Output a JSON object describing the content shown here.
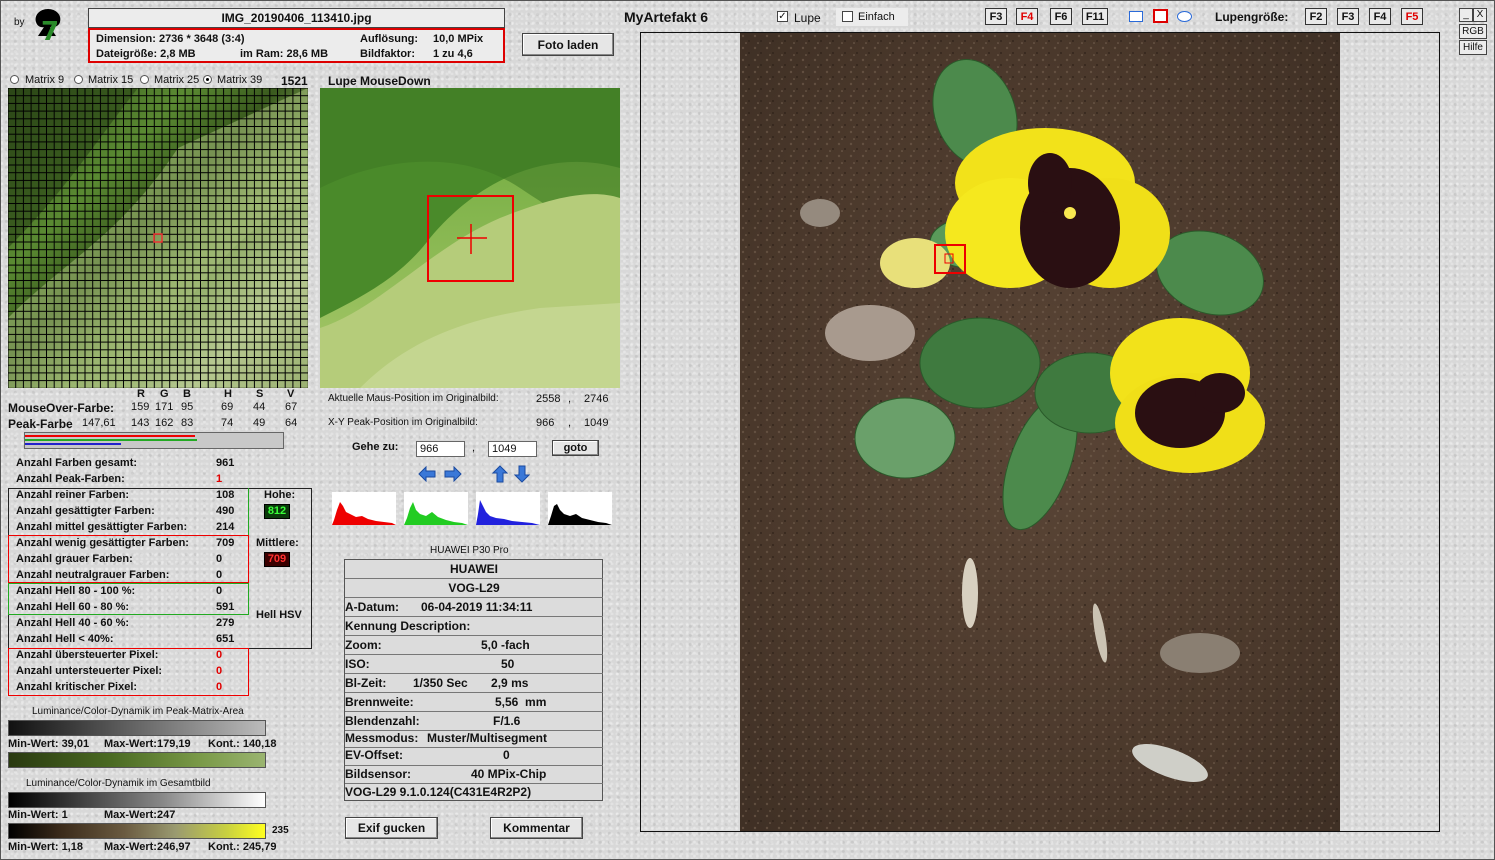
{
  "header": {
    "by_label": "by",
    "filename": "IMG_20190406_113410.jpg",
    "dimension": "Dimension: 2736 * 3648 (3:4)",
    "resolution_label": "Auflösung:",
    "resolution_value": "10,0 MPix",
    "filesize": "Dateigröße: 2,8 MB",
    "ram": "im Ram: 28,6 MB",
    "factor_label": "Bildfaktor:",
    "factor_value": "1 zu 4,6",
    "load_button": "Foto laden",
    "app_title": "MyArtefakt 6",
    "lupe_label": "Lupe",
    "einfach_label": "Einfach",
    "fkeys_left": [
      "F3",
      "F4",
      "F6",
      "F11"
    ],
    "lupengroesse_label": "Lupengröße:",
    "fkeys_right": [
      "F2",
      "F3",
      "F4",
      "F5"
    ],
    "window_controls": [
      "_",
      "X"
    ],
    "rgb_button": "RGB",
    "hilfe_button": "Hilfe"
  },
  "matrix": {
    "options": [
      "Matrix 9",
      "Matrix 15",
      "Matrix 25",
      "Matrix 39"
    ],
    "selected": "Matrix 39",
    "count": "1521",
    "lupe_title": "Lupe MouseDown"
  },
  "colors": {
    "cols": [
      "R",
      "G",
      "B",
      "H",
      "S",
      "V"
    ],
    "mouseover_label": "MouseOver-Farbe:",
    "mouseover_vals": [
      "159",
      "171",
      "95",
      "69",
      "44",
      "67"
    ],
    "peak_label": "Peak-Farbe",
    "peak_extra": "147,61",
    "peak_vals": [
      "143",
      "162",
      "83",
      "74",
      "49",
      "64"
    ]
  },
  "position": {
    "current_label": "Aktuelle Maus-Position  im Originalbild:",
    "current_x": "2558",
    "current_y": "2746",
    "peak_label": "X-Y Peak-Position  im Originalbild:",
    "peak_x": "966",
    "peak_y": "1049",
    "sep": ",",
    "goto_label": "Gehe zu:",
    "goto_x": "966",
    "goto_y": "1049",
    "goto_button": "goto"
  },
  "stats": {
    "rows": [
      {
        "label": "Anzahl Farben gesamt:",
        "value": "961",
        "red": false
      },
      {
        "label": "Anzahl Peak-Farben:",
        "value": "1",
        "red": true
      },
      {
        "label": "Anzahl reiner Farben:",
        "value": "108",
        "red": false
      },
      {
        "label": "Anzahl gesättigter Farben:",
        "value": "490",
        "red": false
      },
      {
        "label": "Anzahl mittel gesättigter Farben:",
        "value": "214",
        "red": false
      },
      {
        "label": "Anzahl wenig gesättigter Farben:",
        "value": "709",
        "red": false
      },
      {
        "label": "Anzahl grauer Farben:",
        "value": "0",
        "red": false
      },
      {
        "label": "Anzahl neutralgrauer Farben:",
        "value": "0",
        "red": false
      },
      {
        "label": "Anzahl Hell 80 - 100 %:",
        "value": "0",
        "red": false
      },
      {
        "label": "Anzahl Hell 60 - 80 %:",
        "value": "591",
        "red": false
      },
      {
        "label": "Anzahl Hell 40 - 60 %:",
        "value": "279",
        "red": false
      },
      {
        "label": "Anzahl Hell < 40%:",
        "value": "651",
        "red": false
      },
      {
        "label": "Anzahl übersteuerter Pixel:",
        "value": "0",
        "red": true
      },
      {
        "label": "Anzahl untersteuerter Pixel:",
        "value": "0",
        "red": true
      },
      {
        "label": "Anzahl kritischer Pixel:",
        "value": "0",
        "red": true
      }
    ],
    "hohe_label": "Hohe:",
    "hohe_value": "812",
    "mittlere_label": "Mittlere:",
    "mittlere_value": "709",
    "hell_hsv_label": "Hell HSV"
  },
  "dynamics": {
    "peak_title": "Luminance/Color-Dynamik im Peak-Matrix-Area",
    "peak_min": "Min-Wert: 39,01",
    "peak_max": "Max-Wert:179,19",
    "peak_kont": "Kont.: 140,18",
    "total_title": "Luminance/Color-Dynamik im Gesamtbild",
    "total_min": "Min-Wert: 1",
    "total_max": "Max-Wert:247",
    "total_min2": "Min-Wert: 1,18",
    "total_max2": "Max-Wert:246,97",
    "total_kont": "Kont.: 245,79",
    "bar_value": "235"
  },
  "exif": {
    "device": "HUAWEI P30 Pro",
    "make": "HUAWEI",
    "model": "VOG-L29",
    "rows": [
      {
        "label": "A-Datum:",
        "value": "06-04-2019 11:34:11"
      },
      {
        "label": "Kennung Description:",
        "value": ""
      },
      {
        "label": "Zoom:",
        "value": "5,0 -fach"
      },
      {
        "label": "ISO:",
        "value": "50"
      },
      {
        "label": "Bl-Zeit:",
        "value": "1/350 Sec       2,9 ms"
      },
      {
        "label": "Brennweite:",
        "value": "5,56  mm"
      },
      {
        "label": "Blendenzahl:",
        "value": "F/1.6"
      },
      {
        "label": "Messmodus:",
        "value": "Muster/Multisegment"
      },
      {
        "label": "EV-Offset:",
        "value": "0"
      },
      {
        "label": "Bildsensor:",
        "value": "40 MPix-Chip"
      }
    ],
    "firmware": "VOG-L29 9.1.0.124(C431E4R2P2)",
    "exif_button": "Exif gucken",
    "comment_button": "Kommentar"
  },
  "colors_theme": {
    "accent_red": "#e00000",
    "hohe_bg": "#0a3a0a",
    "hohe_fg": "#39ff39",
    "mittlere_bg": "#3a0000",
    "mittlere_fg": "#ff3030"
  }
}
